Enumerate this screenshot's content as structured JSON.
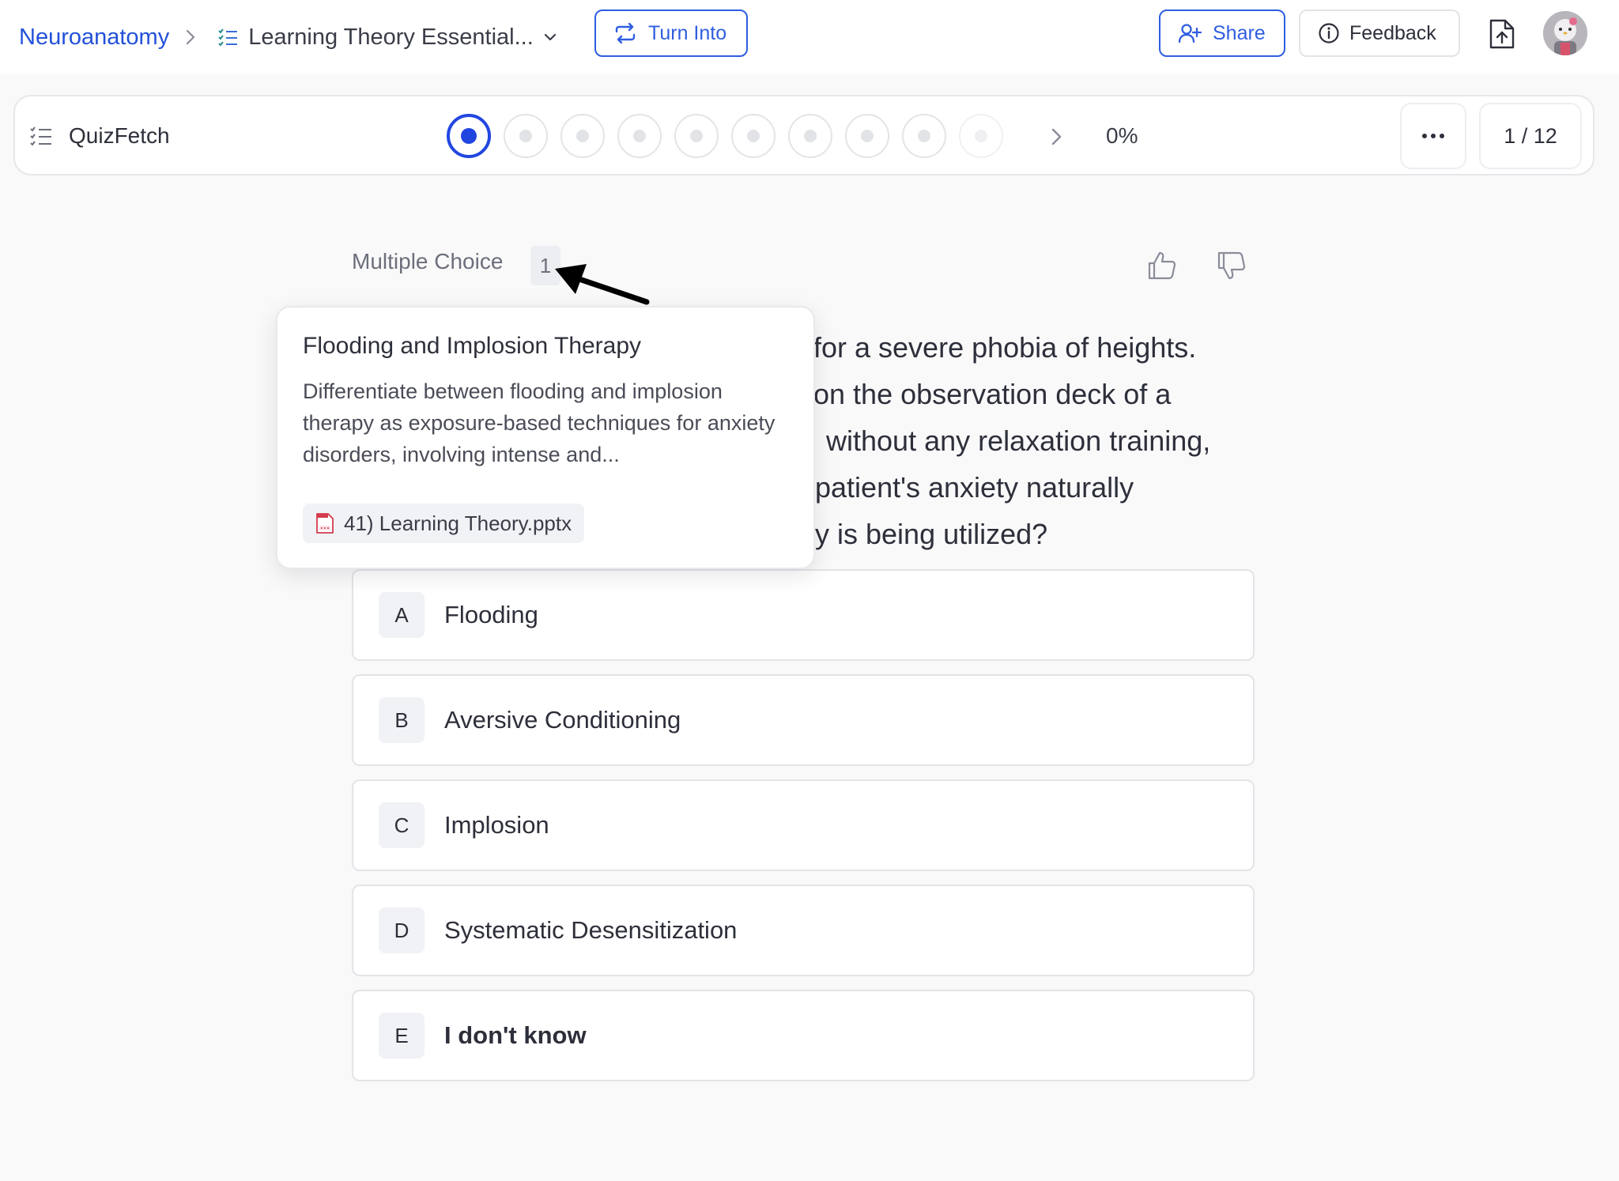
{
  "header": {
    "breadcrumb_root": "Neuroanatomy",
    "breadcrumb_doc": "Learning Theory Essential...",
    "turn_into_label": "Turn Into",
    "share_label": "Share",
    "feedback_label": "Feedback"
  },
  "quizbar": {
    "brand": "QuizFetch",
    "progress_percent_label": "0%",
    "progress_fraction": 0,
    "counter": "1 / 12",
    "steps_visible": 10,
    "current_step": 1
  },
  "question": {
    "type_label": "Multiple Choice",
    "tag_number": "1",
    "text_lines": [
      "for a severe phobia of heights.",
      "on the observation deck of a",
      "without any relaxation training,",
      "patient's anxiety naturally",
      "y is being utilized?"
    ],
    "options": [
      {
        "letter": "A",
        "text": "Flooding"
      },
      {
        "letter": "B",
        "text": "Aversive Conditioning"
      },
      {
        "letter": "C",
        "text": "Implosion"
      },
      {
        "letter": "D",
        "text": "Systematic Desensitization"
      },
      {
        "letter": "E",
        "text": "I don't know"
      }
    ]
  },
  "popover": {
    "title": "Flooding and Implosion Therapy",
    "description": "Differentiate between flooding and implosion therapy as exposure-based techniques for anxiety disorders, involving intense and...",
    "source_file": "41) Learning Theory.pptx"
  },
  "colors": {
    "brand_blue": "#2f5ee0",
    "active_step": "#2146e0",
    "pdf_red": "#d33b4c"
  }
}
